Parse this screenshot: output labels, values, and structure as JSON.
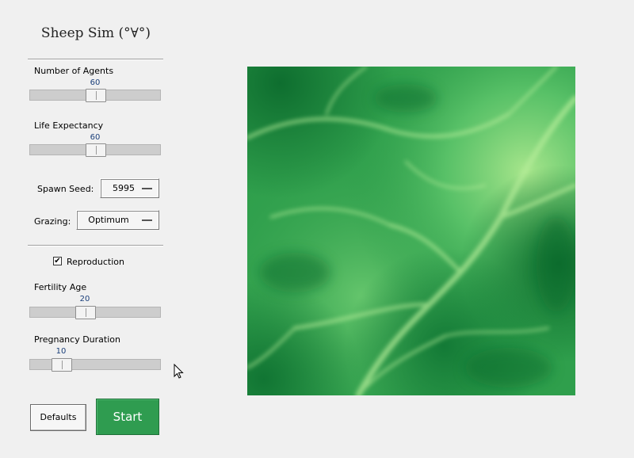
{
  "app": {
    "title": "Sheep Sim (°∀°)"
  },
  "controls": {
    "agents": {
      "label": "Number of Agents",
      "value": "60",
      "fraction": 0.5
    },
    "life": {
      "label": "Life Expectancy",
      "value": "60",
      "fraction": 0.5
    },
    "seed": {
      "label": "Spawn Seed:",
      "value": "5995"
    },
    "grazing": {
      "label": "Grazing:",
      "value": "Optimum"
    },
    "reproduction": {
      "label": "Reproduction",
      "checked": true,
      "check_glyph": "✔"
    },
    "fertility": {
      "label": "Fertility Age",
      "value": "20",
      "fraction": 0.42
    },
    "pregnancy": {
      "label": "Pregnancy Duration",
      "value": "10",
      "fraction": 0.24
    }
  },
  "buttons": {
    "defaults": "Defaults",
    "start": "Start"
  },
  "colors": {
    "terrain_dark": "#117a34",
    "terrain_mid": "#3dbb5a",
    "terrain_light": "#a8e68c",
    "start_button": "#2f9c50"
  }
}
